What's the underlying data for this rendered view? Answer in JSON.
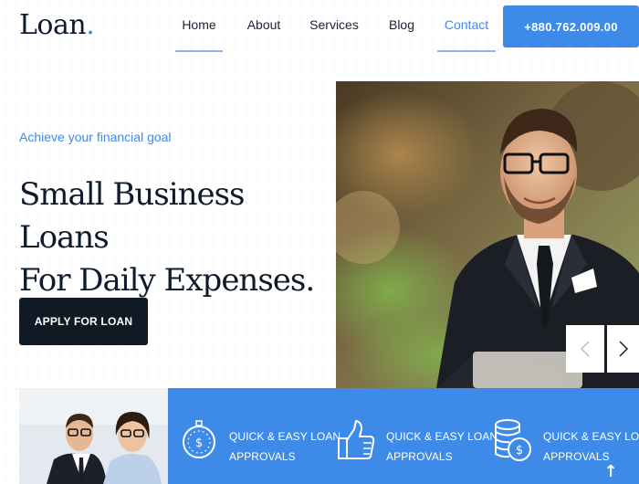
{
  "brand": {
    "name": "Loan",
    "dot": "."
  },
  "nav": {
    "home": "Home",
    "about": "About",
    "services": "Services",
    "blog": "Blog",
    "contact": "Contact"
  },
  "header": {
    "phone": "+880.762.009.00"
  },
  "hero": {
    "eyebrow": "Achieve your financial goal",
    "title_line1": "Small Business Loans",
    "title_line2": "For Daily Expenses.",
    "cta": "APPLY FOR LOAN"
  },
  "slider": {
    "prev_icon": "chevron-left-icon",
    "next_icon": "chevron-right-icon"
  },
  "features": [
    {
      "icon": "clock-dollar-icon",
      "line1": "QUICK & EASY LOAN",
      "line2": "APPROVALS"
    },
    {
      "icon": "thumbs-up-icon",
      "line1": "QUICK & EASY LOAN",
      "line2": "APPROVALS"
    },
    {
      "icon": "coins-icon",
      "line1": "QUICK & EASY LOAN",
      "line2": "APPROVALS"
    }
  ],
  "scroll_top": {
    "glyph": "↑"
  },
  "colors": {
    "accent": "#3d8ae9",
    "dark": "#0f1a24",
    "text": "#0e1b2c"
  }
}
